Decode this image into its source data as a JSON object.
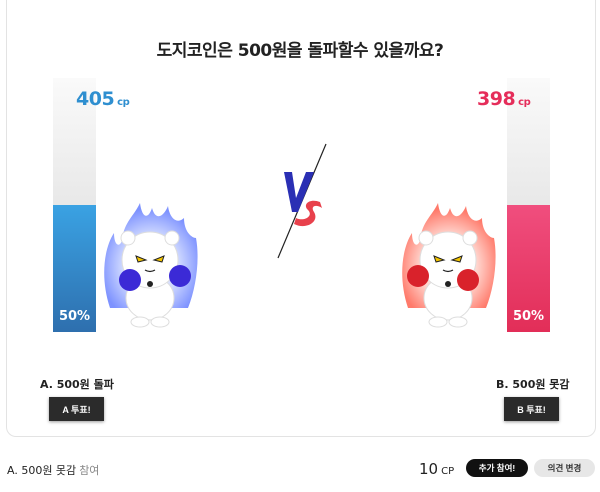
{
  "question": "도지코인은 500원을 돌파할수 있을까요?",
  "option_a": {
    "score": "405",
    "unit": "cp",
    "percent_label": "50%",
    "percent_value": 50,
    "label": "A. 500원 돌파",
    "vote_label": "A 투표!",
    "color": "#3aa2e3"
  },
  "option_b": {
    "score": "398",
    "unit": "cp",
    "percent_label": "50%",
    "percent_value": 50,
    "label": "B. 500원 못감",
    "vote_label": "B 투표!",
    "color": "#e52d5a"
  },
  "footer": {
    "selection": "A. 500원 못감",
    "participation": "참여",
    "my_cp": "10",
    "my_cp_unit": "CP",
    "add_vote_label": "추가 참여!",
    "change_label": "의견 변경"
  },
  "icons": [
    "white-cat-blue-gloves",
    "vs-icon",
    "white-cat-red-gloves"
  ]
}
